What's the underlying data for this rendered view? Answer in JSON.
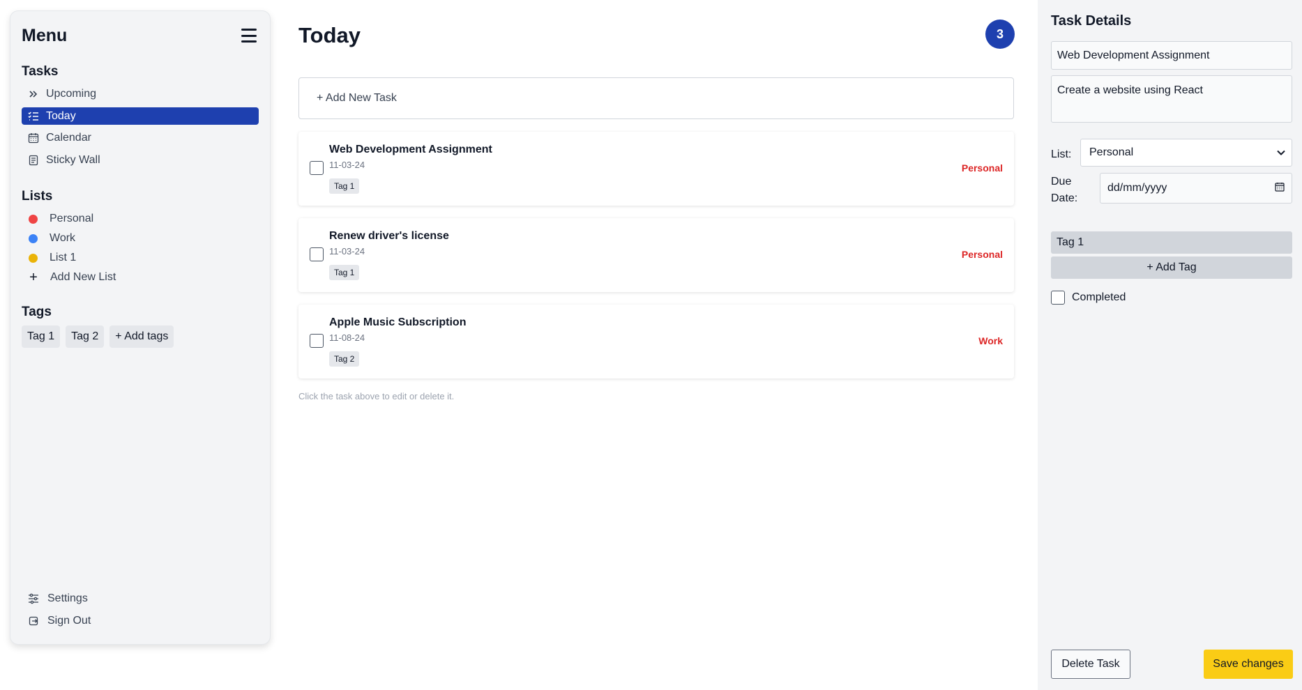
{
  "sidebar": {
    "title": "Menu",
    "tasks_heading": "Tasks",
    "nav": [
      {
        "label": "Upcoming",
        "icon": "double-chevron-right-icon",
        "active": false
      },
      {
        "label": "Today",
        "icon": "list-check-icon",
        "active": true
      },
      {
        "label": "Calendar",
        "icon": "calendar-icon",
        "active": false
      },
      {
        "label": "Sticky Wall",
        "icon": "note-icon",
        "active": false
      }
    ],
    "lists_heading": "Lists",
    "lists": [
      {
        "label": "Personal",
        "color": "#ef4444"
      },
      {
        "label": "Work",
        "color": "#3b82f6"
      },
      {
        "label": "List 1",
        "color": "#eab308"
      }
    ],
    "add_list_label": "Add New List",
    "tags_heading": "Tags",
    "tags": [
      "Tag 1",
      "Tag 2"
    ],
    "add_tags_label": "+ Add tags",
    "settings_label": "Settings",
    "signout_label": "Sign Out",
    "accent_color": "#1e40af"
  },
  "main": {
    "title": "Today",
    "count": "3",
    "add_task_label": "+ Add New Task",
    "tasks": [
      {
        "title": "Web Development Assignment",
        "date": "11-03-24",
        "tag": "Tag 1",
        "list": "Personal"
      },
      {
        "title": "Renew driver's license",
        "date": "11-03-24",
        "tag": "Tag 1",
        "list": "Personal"
      },
      {
        "title": "Apple Music Subscription",
        "date": "11-08-24",
        "tag": "Tag 2",
        "list": "Work"
      }
    ],
    "hint": "Click the task above to edit or delete it."
  },
  "details": {
    "title": "Task Details",
    "task_title": "Web Development Assignment",
    "description": "Create a website using React",
    "list_label": "List:",
    "list_value": "Personal",
    "due_label_1": "Due",
    "due_label_2": "Date:",
    "due_placeholder": "dd/mm/yyyy",
    "tag": "Tag 1",
    "add_tag_label": "+ Add Tag",
    "completed_label": "Completed",
    "delete_label": "Delete Task",
    "save_label": "Save changes",
    "save_color": "#facc15"
  }
}
